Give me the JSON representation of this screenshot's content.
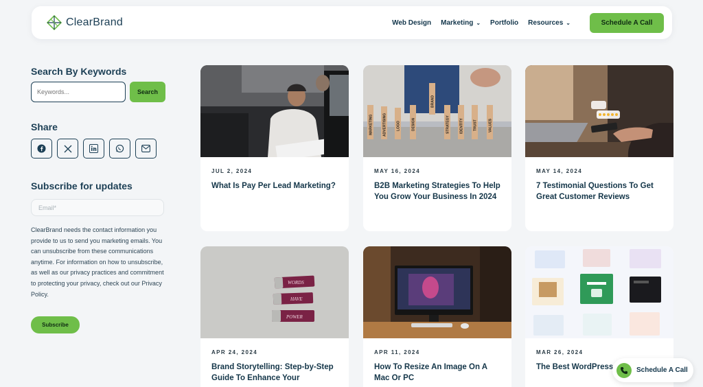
{
  "brand": {
    "name": "ClearBrand",
    "accent": "#6fbe49",
    "text": "#1c3f55"
  },
  "nav": {
    "items": [
      {
        "label": "Web Design",
        "dropdown": false
      },
      {
        "label": "Marketing",
        "dropdown": true
      },
      {
        "label": "Portfolio",
        "dropdown": false
      },
      {
        "label": "Resources",
        "dropdown": true
      }
    ],
    "cta": "Schedule A Call"
  },
  "sidebar": {
    "search_title": "Search By Keywords",
    "search_placeholder": "Keywords...",
    "search_button": "Search",
    "share_title": "Share",
    "share_icons": [
      "facebook-icon",
      "x-icon",
      "linkedin-icon",
      "whatsapp-icon",
      "email-icon"
    ],
    "subscribe_title": "Subscribe for updates",
    "email_placeholder": "Email*",
    "subscribe_text": "ClearBrand needs the contact information you provide to us to send you marketing emails. You can unsubscribe from these communications anytime. For information on how to unsubscribe, as well as our privacy practices and commitment to protecting your privacy, check out our Privacy Policy.",
    "subscribe_button": "Subscribe"
  },
  "posts": [
    {
      "date": "JUL 2, 2024",
      "title": "What Is Pay Per Lead Marketing?"
    },
    {
      "date": "MAY 16, 2024",
      "title": "B2B Marketing Strategies To Help You Grow Your Business In 2024",
      "blocks": [
        "MARKETING",
        "ADVERTISING",
        "LOGO",
        "DESIGN",
        "BRAND",
        "STRATEGY",
        "IDENTITY",
        "TRUST",
        "VALUES"
      ]
    },
    {
      "date": "MAY 14, 2024",
      "title": "7 Testimonial Questions To Get Great Customer Reviews"
    },
    {
      "date": "APR 24, 2024",
      "title": "Brand Storytelling: Step-by-Step Guide To Enhance Your",
      "erasers": [
        "WORDS",
        "HAVE",
        "POWER"
      ]
    },
    {
      "date": "APR 11, 2024",
      "title": "How To Resize An Image On A Mac Or PC"
    },
    {
      "date": "MAR 26, 2024",
      "title": "The Best WordPress 2024"
    }
  ],
  "float_cta": "Schedule A Call"
}
